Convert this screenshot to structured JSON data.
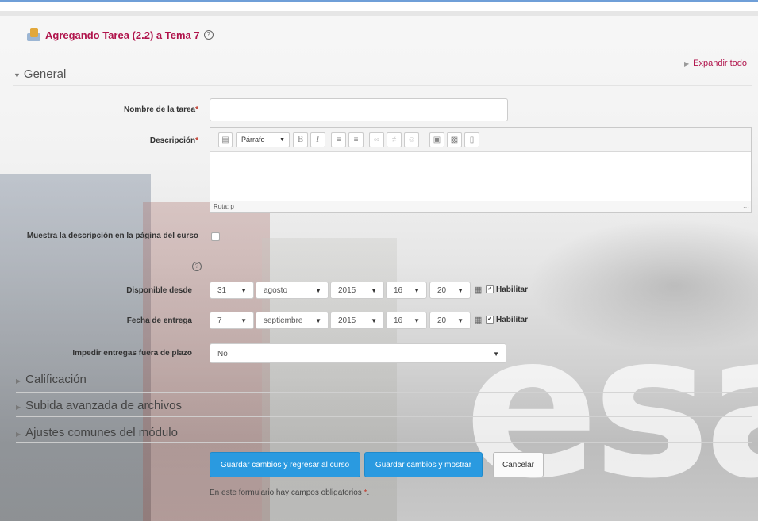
{
  "header": {
    "title": "Agregando Tarea (2.2) a Tema 7",
    "help_icon": "question-circle-icon"
  },
  "actions": {
    "expand_all": "Expandir todo"
  },
  "general": {
    "legend": "General",
    "task_name": {
      "label": "Nombre de la tarea",
      "required_mark": "*",
      "value": ""
    },
    "description": {
      "label": "Descripción",
      "required_mark": "*",
      "format_select": "Párrafo",
      "bold": "B",
      "italic": "I",
      "path": "Ruta: p",
      "toolbar_icons": [
        "show-more-icon",
        "bold-icon",
        "italic-icon",
        "unordered-list-icon",
        "ordered-list-icon",
        "link-icon",
        "unlink-icon",
        "emoticon-icon",
        "image-icon",
        "media-icon",
        "manage-files-icon"
      ]
    },
    "show_description": {
      "label": "Muestra la descripción en la página del curso",
      "checked": false
    },
    "available_from": {
      "label": "Disponible desde",
      "day": "31",
      "month": "agosto",
      "year": "2015",
      "hour": "16",
      "minute": "20",
      "enable_label": "Habilitar",
      "enabled": true
    },
    "due_date": {
      "label": "Fecha de entrega",
      "day": "7",
      "month": "septiembre",
      "year": "2015",
      "hour": "16",
      "minute": "20",
      "enable_label": "Habilitar",
      "enabled": true
    },
    "prevent_late": {
      "label": "Impedir entregas fuera de plazo",
      "value": "No"
    }
  },
  "sections": [
    {
      "label": "Calificación"
    },
    {
      "label": "Subida avanzada de archivos"
    },
    {
      "label": "Ajustes comunes del módulo"
    }
  ],
  "buttons": {
    "save_return": "Guardar cambios y regresar al curso",
    "save_display": "Guardar cambios y mostrar",
    "cancel": "Cancelar"
  },
  "footer_note": {
    "text": "En este formulario hay campos obligatorios",
    "mark": "*",
    "end": "."
  },
  "background_sign": "esan",
  "colors": {
    "title": "#b0134b",
    "primary_button": "#2a9ae0",
    "required": "#c0392b"
  }
}
